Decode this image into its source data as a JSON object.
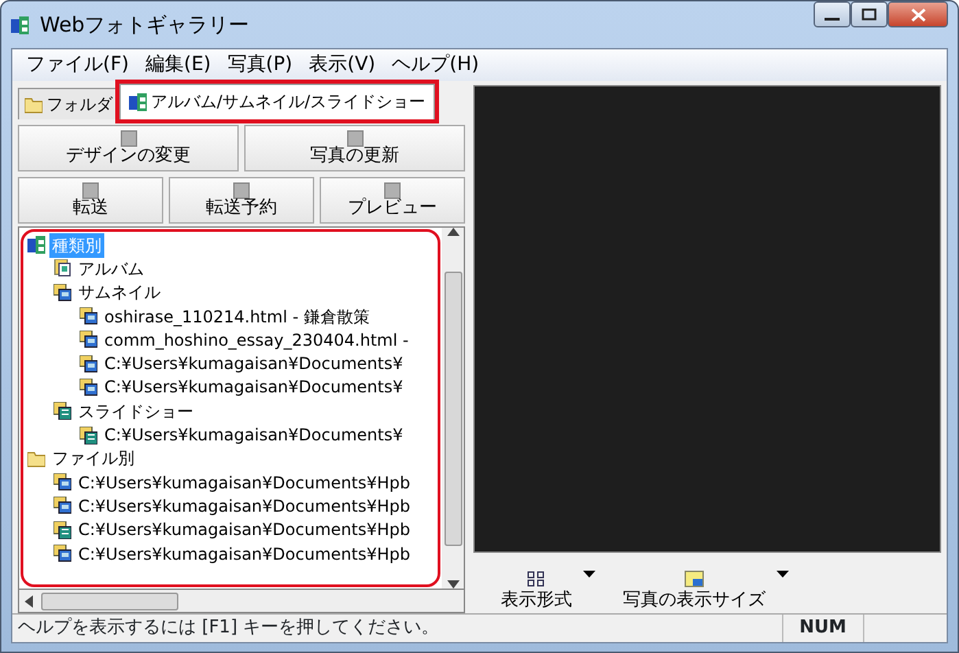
{
  "window": {
    "title": "Webフォトギャラリー"
  },
  "menu": [
    "ファイル(F)",
    "編集(E)",
    "写真(P)",
    "表示(V)",
    "ヘルプ(H)"
  ],
  "tabs": [
    {
      "label": "フォルダ",
      "selected": false,
      "highlighted": false
    },
    {
      "label": "アルバム/サムネイル/スライドショー",
      "selected": true,
      "highlighted": true
    }
  ],
  "tool_rows": [
    [
      {
        "label": "デザインの変更"
      },
      {
        "label": "写真の更新"
      }
    ],
    [
      {
        "label": "転送"
      },
      {
        "label": "転送予約"
      },
      {
        "label": "プレビュー"
      }
    ]
  ],
  "tree": {
    "highlighted": true,
    "items": [
      {
        "label": "種類別",
        "kind": "category",
        "selected": true,
        "children": [
          {
            "label": "アルバム",
            "kind": "album",
            "selected": false
          },
          {
            "label": "サムネイル",
            "kind": "thumbnail",
            "selected": false,
            "children": [
              {
                "label": "oshirase_110214.html - 鎌倉散策",
                "kind": "thumbnail",
                "selected": false
              },
              {
                "label": "comm_hoshino_essay_230404.html -",
                "kind": "thumbnail",
                "selected": false
              },
              {
                "label": "C:¥Users¥kumagaisan¥Documents¥",
                "kind": "thumbnail",
                "selected": false
              },
              {
                "label": "C:¥Users¥kumagaisan¥Documents¥",
                "kind": "thumbnail",
                "selected": false
              }
            ]
          },
          {
            "label": "スライドショー",
            "kind": "slideshow",
            "selected": false,
            "children": [
              {
                "label": "C:¥Users¥kumagaisan¥Documents¥",
                "kind": "slideshow",
                "selected": false
              }
            ]
          }
        ]
      },
      {
        "label": "ファイル別",
        "kind": "folder",
        "selected": false,
        "children": [
          {
            "label": "C:¥Users¥kumagaisan¥Documents¥Hpb",
            "kind": "thumbnail",
            "selected": false
          },
          {
            "label": "C:¥Users¥kumagaisan¥Documents¥Hpb",
            "kind": "thumbnail",
            "selected": false
          },
          {
            "label": "C:¥Users¥kumagaisan¥Documents¥Hpb",
            "kind": "slideshow",
            "selected": false
          },
          {
            "label": "C:¥Users¥kumagaisan¥Documents¥Hpb",
            "kind": "thumbnail",
            "selected": false
          }
        ]
      }
    ]
  },
  "view_toolbar": [
    {
      "label": "表示形式",
      "kind": "layout"
    },
    {
      "label": "写真の表示サイズ",
      "kind": "size"
    }
  ],
  "status_bar": {
    "text": "ヘルプを表示するには [F1] キーを押してください。",
    "indicator": "NUM"
  }
}
